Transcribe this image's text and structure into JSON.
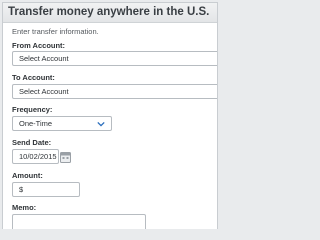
{
  "header": {
    "title": "Transfer money anywhere in the U.S."
  },
  "intro": "Enter transfer information.",
  "from_account": {
    "label": "From Account:",
    "value": "Select Account"
  },
  "to_account": {
    "label": "To Account:",
    "value": "Select Account"
  },
  "frequency": {
    "label": "Frequency:",
    "value": "One-Time",
    "icon": "chevron-down-icon"
  },
  "send_date": {
    "label": "Send Date:",
    "value": "10/02/2015",
    "icon": "calendar-icon"
  },
  "amount": {
    "label": "Amount:",
    "value": "$"
  },
  "memo": {
    "label": "Memo:",
    "value": ""
  },
  "colors": {
    "accent": "#2a6ebd"
  }
}
